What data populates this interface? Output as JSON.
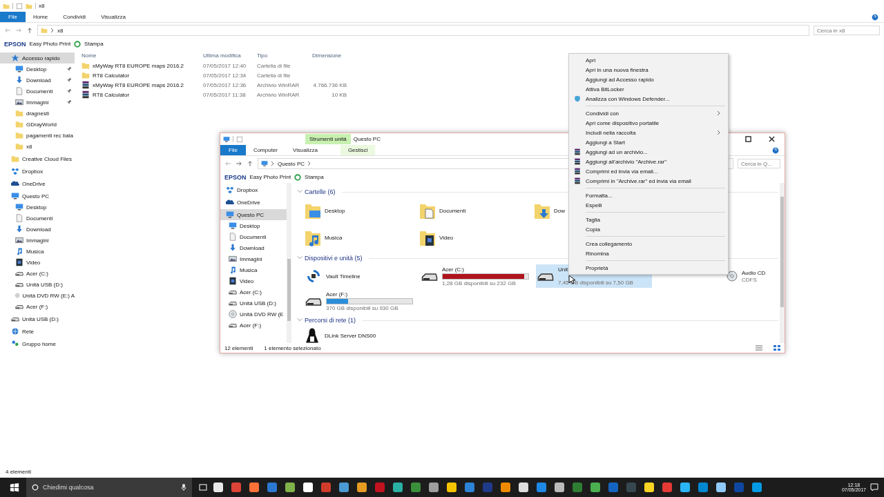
{
  "window": {
    "title": "x8",
    "tabs": [
      {
        "label": "File",
        "selected": true
      },
      {
        "label": "Home",
        "selected": false
      },
      {
        "label": "Condividi",
        "selected": false
      },
      {
        "label": "Visualizza",
        "selected": false
      }
    ],
    "address": "x8",
    "search": {
      "placeholder": "Cerca in x8"
    }
  },
  "favorites_bar": {
    "brand": "EPSON",
    "app": "Easy Photo Print",
    "action": "Stampa"
  },
  "sidebar": {
    "items": [
      {
        "label": "Accesso rapido",
        "kind": "star",
        "selected": true,
        "children": [
          {
            "label": "Desktop",
            "kind": "desktop",
            "pinned": true
          },
          {
            "label": "Download",
            "kind": "download",
            "pinned": true
          },
          {
            "label": "Documenti",
            "kind": "documents",
            "pinned": true
          },
          {
            "label": "Immagini",
            "kind": "pictures",
            "pinned": true
          },
          {
            "label": "dragnesti",
            "kind": "folder",
            "pinned": false
          },
          {
            "label": "GDrayWorld",
            "kind": "folder",
            "pinned": false
          },
          {
            "label": "pagamenti rec bala",
            "kind": "folder",
            "pinned": false
          },
          {
            "label": "x8",
            "kind": "folder",
            "pinned": false
          }
        ]
      },
      {
        "label": "Creative Cloud Files",
        "kind": "folder",
        "selected": false
      },
      {
        "label": "Dropbox",
        "kind": "dropbox",
        "selected": false
      },
      {
        "label": "OneDrive",
        "kind": "onedrive",
        "selected": false
      },
      {
        "label": "Questo PC",
        "kind": "pc",
        "selected": false,
        "children": [
          {
            "label": "Desktop",
            "kind": "desktop",
            "pinned": false
          },
          {
            "label": "Documenti",
            "kind": "documents",
            "pinned": false
          },
          {
            "label": "Download",
            "kind": "download",
            "pinned": false
          },
          {
            "label": "Immagini",
            "kind": "pictures",
            "pinned": false
          },
          {
            "label": "Musica",
            "kind": "music",
            "pinned": false
          },
          {
            "label": "Video",
            "kind": "video",
            "pinned": false
          },
          {
            "label": "Acer (C:)",
            "kind": "drive",
            "pinned": false
          },
          {
            "label": "Unità USB (D:)",
            "kind": "usb",
            "pinned": false
          },
          {
            "label": "Unità DVD RW (E:) A",
            "kind": "dvd",
            "pinned": false
          },
          {
            "label": "Acer (F:)",
            "kind": "usb",
            "pinned": false
          }
        ]
      },
      {
        "label": "Unità USB (D:)",
        "kind": "usb",
        "selected": false
      },
      {
        "label": "Rete",
        "kind": "network",
        "selected": false
      },
      {
        "label": "Gruppo home",
        "kind": "homegroup",
        "selected": false
      }
    ]
  },
  "table": {
    "columns": [
      "Nome",
      "Ultima modifica",
      "Tipo",
      "Dimensione"
    ],
    "rows": [
      {
        "kind": "folder",
        "cells": [
          "xMyWay RT8 EUROPE maps 2016.2",
          "07/05/2017 12:40",
          "Cartella di file",
          ""
        ]
      },
      {
        "kind": "folder",
        "cells": [
          "RT8 Calculator",
          "07/05/2017 12:34",
          "Cartella di file",
          ""
        ]
      },
      {
        "kind": "archive",
        "cells": [
          "xMyWay RT8 EUROPE maps 2016.2",
          "07/05/2017 12:36",
          "Archivio WinRAR",
          "4.766.736 KB"
        ]
      },
      {
        "kind": "archive",
        "cells": [
          "RT8 Calculator",
          "07/05/2017 11:38",
          "Archivio WinRAR",
          "10 KB"
        ]
      }
    ]
  },
  "status_bar": "4 elementi",
  "inner_window": {
    "title": "Questo PC",
    "context_tab": "Strumenti unità",
    "tabs": [
      {
        "label": "File",
        "selected": true
      },
      {
        "label": "Computer",
        "selected": false
      },
      {
        "label": "Visualizza",
        "selected": false
      },
      {
        "label": "Gestisci",
        "selected": false
      }
    ],
    "address": "Questo PC",
    "search": {
      "placeholder": "Cerca in Q..."
    },
    "favorites_bar": {
      "brand": "EPSON",
      "app": "Easy Photo Print",
      "action": "Stampa"
    },
    "sidebar": [
      {
        "label": "Dropbox",
        "kind": "dropbox",
        "selected": false
      },
      {
        "label": "OneDrive",
        "kind": "onedrive",
        "selected": false
      },
      {
        "label": "Questo PC",
        "kind": "pc",
        "selected": true,
        "children": [
          {
            "label": "Desktop",
            "kind": "desktop"
          },
          {
            "label": "Documenti",
            "kind": "documents"
          },
          {
            "label": "Download",
            "kind": "download"
          },
          {
            "label": "Immagini",
            "kind": "pictures"
          },
          {
            "label": "Musica",
            "kind": "music"
          },
          {
            "label": "Video",
            "kind": "video"
          },
          {
            "label": "Acer (C:)",
            "kind": "drive"
          },
          {
            "label": "Unità USB (D:)",
            "kind": "usb"
          },
          {
            "label": "Unità DVD RW (E",
            "kind": "dvd"
          },
          {
            "label": "Acer (F:)",
            "kind": "usb"
          }
        ]
      }
    ],
    "groups": [
      {
        "title": "Cartelle (6)",
        "expanded": true,
        "kind": "folders",
        "items": [
          {
            "label": "Desktop",
            "kind": "desktop"
          },
          {
            "label": "Documenti",
            "kind": "documents"
          },
          {
            "label": "Dow",
            "kind": "download"
          },
          {
            "label": "Musica",
            "kind": "music"
          },
          {
            "label": "Video",
            "kind": "video"
          }
        ]
      },
      {
        "title": "Dispositivi e unità (5)",
        "expanded": true,
        "kind": "drives",
        "items": [
          {
            "label": "Vault Timeline",
            "kind": "sync",
            "selected": false
          },
          {
            "label": "Acer (C:)",
            "kind": "drive",
            "detail": "1,28 GB disponibili su 232 GB",
            "level": 0.95,
            "selected": false
          },
          {
            "label": "Unit",
            "kind": "usb",
            "detail": "7,45 GB disponibili su 7,50 GB",
            "selected": true
          },
          {
            "label": "Audio CD",
            "kind": "dvd",
            "extra": "CDFS",
            "selected": false
          },
          {
            "label": "Acer (F:)",
            "kind": "usb",
            "detail": "370 GB disponibili su 930 GB",
            "level": 0.25,
            "selected": false
          }
        ]
      },
      {
        "title": "Percorsi di rete (1)",
        "expanded": true,
        "kind": "network",
        "items": [
          {
            "label": "DLink Server DNS00",
            "kind": "server"
          }
        ]
      }
    ],
    "status": [
      "12 elementi",
      "1 elemento selezionato"
    ]
  },
  "context_menu": {
    "groups": [
      [
        {
          "label": "Apri",
          "kind": "plain",
          "submenu": false
        },
        {
          "label": "Apri in una nuova finestra",
          "kind": "plain",
          "submenu": false
        },
        {
          "label": "Aggiungi ad Accesso rapido",
          "kind": "plain",
          "submenu": false
        },
        {
          "label": "Attiva BitLocker",
          "kind": "plain",
          "submenu": false
        },
        {
          "label": "Analizza con Windows Defender...",
          "kind": "defender",
          "submenu": false
        }
      ],
      [
        {
          "label": "Condividi con",
          "kind": "plain",
          "submenu": true
        },
        {
          "label": "Apri come dispositivo portatile",
          "kind": "plain",
          "submenu": false
        },
        {
          "label": "Includi nella raccolta",
          "kind": "plain",
          "submenu": true
        },
        {
          "label": "Aggiungi a Start",
          "kind": "plain",
          "submenu": false
        },
        {
          "label": "Aggiungi ad un archivio...",
          "kind": "archive",
          "submenu": false
        },
        {
          "label": "Aggiungi all'archivio \"Archive.rar\"",
          "kind": "archive",
          "submenu": false
        },
        {
          "label": "Comprimi ed invia via email...",
          "kind": "archive",
          "submenu": false
        },
        {
          "label": "Comprimi in \"Archive.rar\" ed invia via email",
          "kind": "archive",
          "submenu": false
        }
      ],
      [
        {
          "label": "Formatta...",
          "kind": "plain",
          "submenu": false
        },
        {
          "label": "Espelli",
          "kind": "plain",
          "submenu": false
        }
      ],
      [
        {
          "label": "Taglia",
          "kind": "plain",
          "submenu": false
        },
        {
          "label": "Copia",
          "kind": "plain",
          "submenu": false
        }
      ],
      [
        {
          "label": "Crea collegamento",
          "kind": "plain",
          "submenu": false
        },
        {
          "label": "Rinomina",
          "kind": "plain",
          "submenu": false
        }
      ],
      [
        {
          "label": "Proprietà",
          "kind": "plain",
          "submenu": false
        }
      ]
    ]
  },
  "taskbar": {
    "search": {
      "placeholder": "Chiedimi qualcosa"
    },
    "time": "12:18",
    "date": "07/05/2017"
  }
}
